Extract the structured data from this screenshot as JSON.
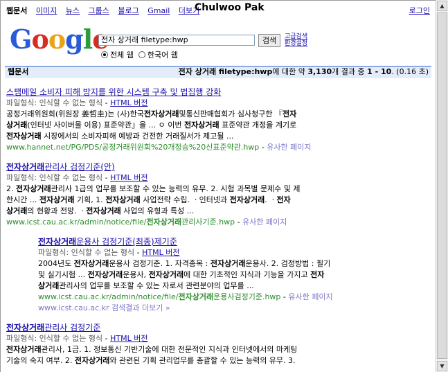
{
  "overlay_title": "Chulwoo Pak",
  "nav": {
    "items": [
      "웹문서",
      "이미지",
      "뉴스",
      "그룹스",
      "블로그",
      "Gmail",
      "더보기"
    ],
    "login": "로그인"
  },
  "logo_text": "Google",
  "search": {
    "query": "전자 상거래 filetype:hwp",
    "button": "검색",
    "advanced": "고급검색",
    "prefs": "환경설정",
    "radio_all": "전체 웹",
    "radio_korean": "한국어 웹"
  },
  "bar": {
    "left": "웹문서",
    "query_bold": "전자 상거래 filetype:hwp",
    "text_prefix": "에 대한 약",
    "count": "3,130",
    "text_mid": "개 결과 중",
    "range": "1 - 10",
    "time": ". (0.16 초)"
  },
  "results": [
    {
      "title": "스팸메일 소비자 피해 방지를 위한 시스템 구축 및 법집행 강화",
      "filetype": "파일형식: 인식할 수 없는 형식",
      "html_version": "HTML 버전",
      "snippet1": "공정거래위원회(위원장 姜哲圭)는 (사)한국전자상거래및통신판매협회가 심사청구한 『전자",
      "snippet2": "상거래(인터넷 사이버몰 이용) 표준약관』을 ... ㅇ 이번 전자상거래 표준약관 개정을 계기로",
      "snippet3": "전자상거래 시장에서의 소비자피해 예방과 건전한 거래질서가 제고될 ...",
      "url": "www.hannet.net/PG/PDS/공정거래위원회%20개정승%20신표준약관.hwp",
      "similar": "유사한 페이지"
    },
    {
      "title": "전자상거래관리사 검정기준(안)",
      "filetype": "파일형식: 인식할 수 없는 형식",
      "html_version": "HTML 버전",
      "snippet1": "2. 전자상거래관리사 1급의 업무를 보조할 수 있는 능력의 유무. 2. 시험 과목별 문제수 및 제",
      "snippet2": "한시간 ... 전자상거래 기획, 1. 전자상거래 사업전략 수립. ㆍ인터넷과 전자상거래. ㆍ전자",
      "snippet3": "상거래의 현황과 전망. ㆍ전자상거래 사업의 유형과 특성 ...",
      "url": "www.icst.cau.ac.kr/admin/notice/file/전자상거래관리사기준.hwp",
      "similar": "유사한 페이지"
    },
    {
      "title": "전자상거래운용사 검정기준(최종)제기준",
      "filetype": "파일형식: 인식할 수 없는 형식",
      "html_version": "HTML 버전",
      "snippet1": "2004년도 전자상거래운용사 검정기준. 1. 자격종목 : 전자상거래운용사. 2. 검정방법 : 필기",
      "snippet2": "및 실기시험 ... 전자상거래운용사, 전자상거래에 대한 기초적인 지식과 기능을 가지고 전자",
      "snippet3": "상거래관리사의 업무를 보조할 수 있는 자로서 관련분야의 업무를 ...",
      "url": "www.icst.cau.ac.kr/admin/notice/file/전자상거래운용사검정기준.hwp",
      "similar": "유사한 페이지",
      "more": "www.icst.cau.ac.kr 검색결과 더보기 »"
    },
    {
      "title": "전자상거래관리사 검정기준",
      "filetype": "파일형식: 인식할 수 없는 형식",
      "html_version": "HTML 버전",
      "snippet1": "전자상거래관리사, 1급. 1. 정보통신 기반기술에 대한 전문적인 지식과 인터넷에서의 마케팅",
      "snippet2": "기술의 숙지 여부. 2. 전자상거래와 관련된 기획 관리업무를 총괄할 수 있는 능력의 유무. 3."
    }
  ]
}
